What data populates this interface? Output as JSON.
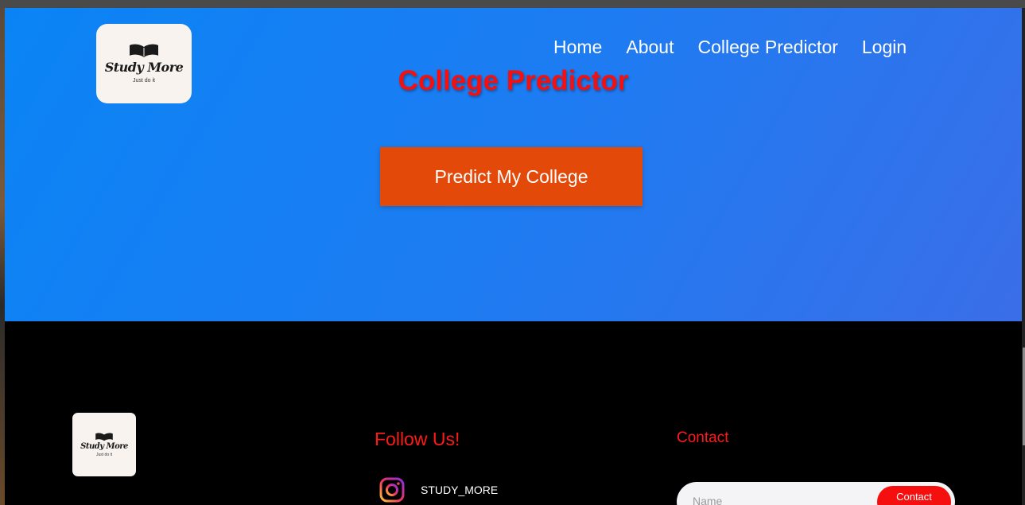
{
  "brand": {
    "logo_name": "Study More",
    "logo_tagline": "Just do it"
  },
  "nav": {
    "items": [
      {
        "label": "Home"
      },
      {
        "label": "About"
      },
      {
        "label": "College Predictor"
      },
      {
        "label": "Login"
      }
    ]
  },
  "hero": {
    "title": "College Predictor",
    "cta_label": "Predict My College"
  },
  "footer": {
    "follow_title": "Follow Us!",
    "instagram_handle": "STUDY_MORE",
    "contact_title": "Contact",
    "contact_placeholder": "Name",
    "contact_button": "Contact"
  },
  "colors": {
    "hero_bg": "#1d7cf2",
    "accent_red": "#f50f0f",
    "cta_orange": "#e34a0a",
    "footer_bg": "#000000"
  },
  "icons": [
    "open-book-icon",
    "instagram-icon"
  ]
}
